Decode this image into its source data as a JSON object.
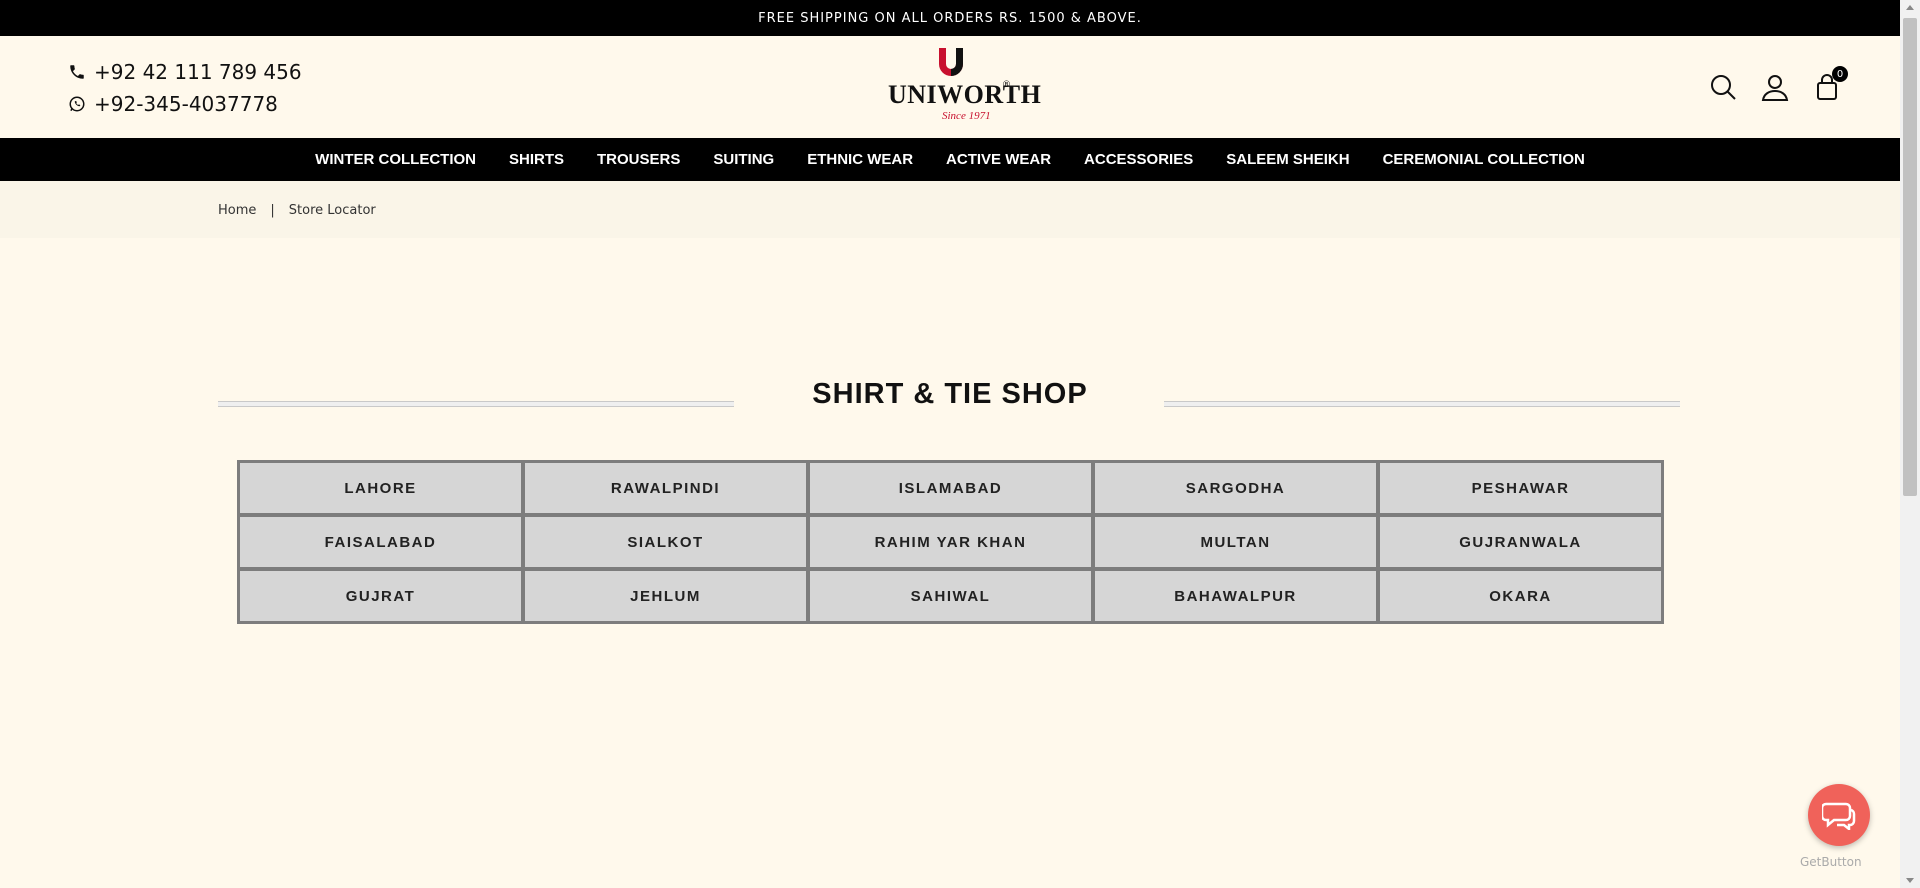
{
  "announcement": "FREE SHIPPING ON ALL ORDERS RS. 1500 & ABOVE.",
  "contact": {
    "phone": "+92 42 111 789 456",
    "whatsapp": "+92-345-4037778"
  },
  "logo": {
    "word": "UNIWORTH",
    "reg": "®",
    "since": "Since 1971",
    "brand_red": "#c8102e"
  },
  "header_icons": [
    "search-icon",
    "user-icon",
    "cart-icon"
  ],
  "cart_count": "0",
  "nav": [
    "WINTER COLLECTION",
    "SHIRTS",
    "TROUSERS",
    "SUITING",
    "ETHNIC WEAR",
    "ACTIVE WEAR",
    "ACCESSORIES",
    "SALEEM SHEIKH",
    "CEREMONIAL COLLECTION"
  ],
  "breadcrumb": {
    "home": "Home",
    "separator": "|",
    "current": "Store Locator"
  },
  "section_title": "SHIRT & TIE SHOP",
  "cities": [
    "LAHORE",
    "RAWALPINDI",
    "ISLAMABAD",
    "SARGODHA",
    "PESHAWAR",
    "FAISALABAD",
    "SIALKOT",
    "RAHIM YAR KHAN",
    "MULTAN",
    "GUJRANWALA",
    "GUJRAT",
    "JEHLUM",
    "SAHIWAL",
    "BAHAWALPUR",
    "OKARA"
  ],
  "getbutton_label": "GetButton",
  "colors": {
    "page_bg": "#fff9ec",
    "nav_bg": "#000000",
    "cell_bg": "#d6d6d6",
    "chat_button": "#f0625a"
  }
}
